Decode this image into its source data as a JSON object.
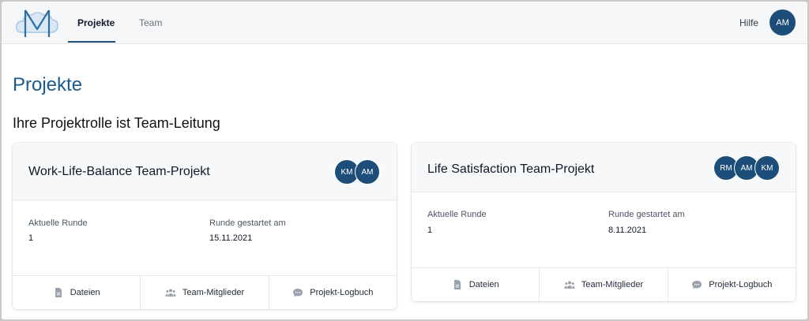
{
  "nav": {
    "tabs": [
      {
        "label": "Projekte",
        "active": true
      },
      {
        "label": "Team",
        "active": false
      }
    ],
    "help_label": "Hilfe",
    "user_initials": "AM"
  },
  "page": {
    "title": "Projekte",
    "role_text": "Ihre Projektrolle ist Team-Leitung"
  },
  "projects": [
    {
      "title": "Work-Life-Balance Team-Projekt",
      "members": [
        "KM",
        "AM"
      ],
      "round_label": "Aktuelle Runde",
      "round_value": "1",
      "started_label": "Runde gestartet am",
      "started_value": "15.11.2021",
      "actions": [
        "Dateien",
        "Team-Mitglieder",
        "Projekt-Logbuch"
      ]
    },
    {
      "title": "Life Satisfaction Team-Projekt",
      "members": [
        "RM",
        "AM",
        "KM"
      ],
      "round_label": "Aktuelle Runde",
      "round_value": "1",
      "started_label": "Runde gestartet am",
      "started_value": "8.11.2021",
      "actions": [
        "Dateien",
        "Team-Mitglieder",
        "Projekt-Logbuch"
      ]
    }
  ],
  "icons": {
    "files": "document-icon",
    "members": "people-icon",
    "logbook": "chat-bubble-icon"
  },
  "colors": {
    "accent": "#1d4e79",
    "title": "#1b5a8a"
  }
}
